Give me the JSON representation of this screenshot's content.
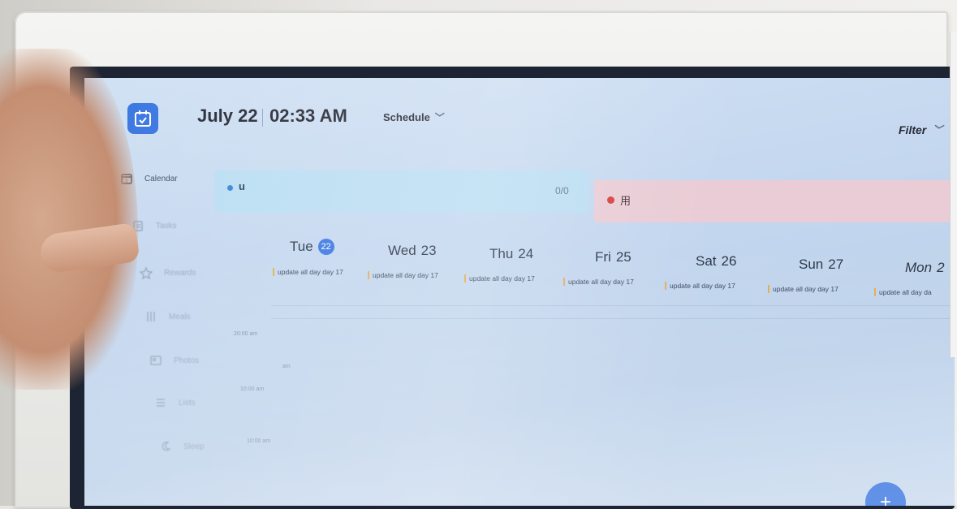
{
  "header": {
    "date": "July 22",
    "time": "02:33 AM",
    "view_mode": "Schedule",
    "filter_label": "Filter"
  },
  "sidebar": {
    "items": [
      {
        "label": "Calendar",
        "icon": "calendar-icon"
      },
      {
        "label": "Tasks",
        "icon": "tasks-icon"
      },
      {
        "label": "Rewards",
        "icon": "star-icon"
      },
      {
        "label": "Meals",
        "icon": "meals-icon"
      },
      {
        "label": "Photos",
        "icon": "photos-icon"
      },
      {
        "label": "Lists",
        "icon": "lists-icon"
      },
      {
        "label": "Sleep",
        "icon": "sleep-icon"
      }
    ]
  },
  "agenda": {
    "user_u": {
      "label": "u",
      "count": "0/0",
      "color": "#2b7fd8"
    },
    "user_cn": {
      "label": "用",
      "color": "#d2342f"
    }
  },
  "week": {
    "days": [
      {
        "name": "Tue",
        "num": "22",
        "today": true
      },
      {
        "name": "Wed",
        "num": "23"
      },
      {
        "name": "Thu",
        "num": "24"
      },
      {
        "name": "Fri",
        "num": "25"
      },
      {
        "name": "Sat",
        "num": "26"
      },
      {
        "name": "Sun",
        "num": "27"
      },
      {
        "name": "Mon",
        "num": "2"
      }
    ],
    "all_day_events": [
      "update all day day 17",
      "update all day day 17",
      "update all day day 17",
      "update all day day 17",
      "update all day day 17",
      "update all day day 17",
      "update all day da"
    ]
  },
  "time_rail": [
    "20:00 am",
    "am",
    "10:00 am",
    "10:00 am"
  ],
  "fab_label": "+",
  "accent_color": "#2f6fe0"
}
